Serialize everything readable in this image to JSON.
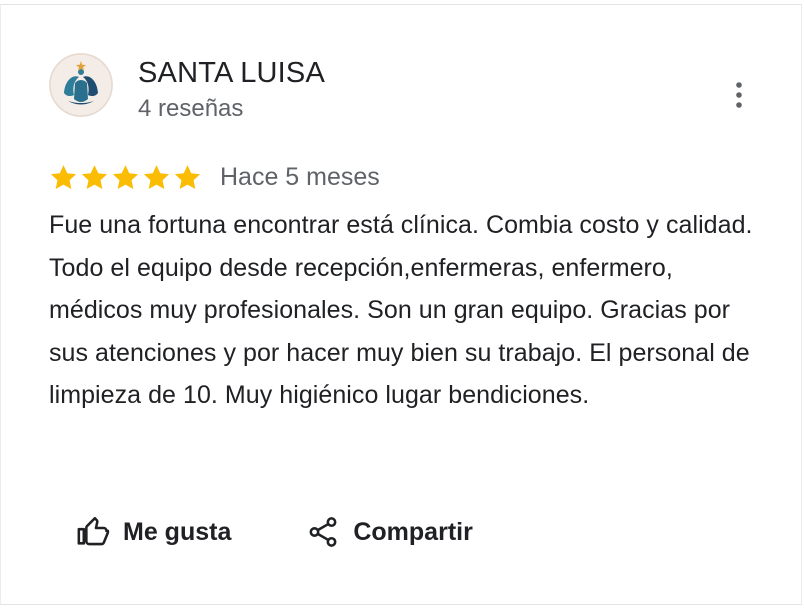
{
  "review": {
    "author": {
      "name": "SANTA LUISA",
      "review_count": "4 reseñas",
      "avatar_icon": "clinic-logo-icon"
    },
    "rating": 5,
    "rating_max": 5,
    "time_ago": "Hace 5 meses",
    "text": "Fue una fortuna encontrar está clínica. Combia costo y calidad. Todo el equipo desde recepción,enfermeras, enfermero, médicos muy profesionales. Son un gran equipo. Gracias por sus atenciones y por hacer muy bien su trabajo. El personal de limpieza de 10. Muy higiénico lugar bendiciones."
  },
  "actions": {
    "like_label": "Me gusta",
    "share_label": "Compartir"
  },
  "icons": {
    "more": "more-vert-icon",
    "like": "thumb-up-icon",
    "share": "share-icon",
    "star": "star-icon"
  },
  "colors": {
    "star": "#fbbc04",
    "text_primary": "#202124",
    "text_secondary": "#5f6368",
    "avatar_teal": "#2e7e9a",
    "avatar_navy": "#1f4e72",
    "avatar_bg": "#f4ece6"
  }
}
